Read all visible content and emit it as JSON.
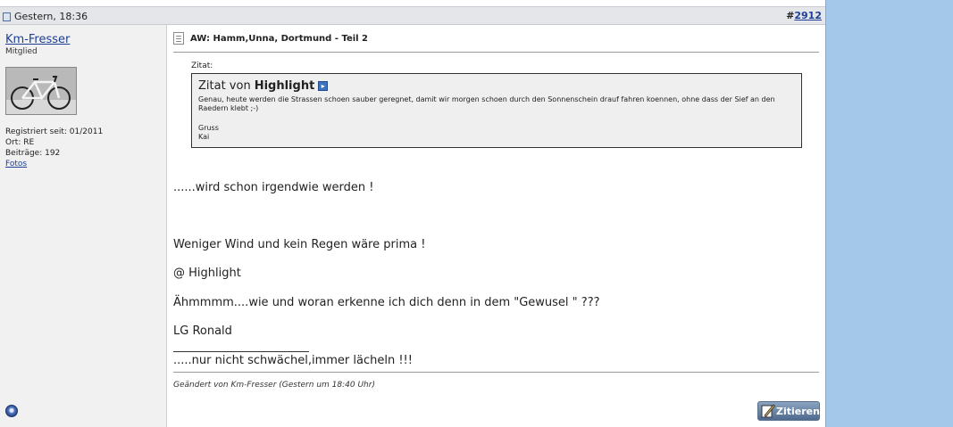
{
  "header": {
    "date": "Gestern, 18:36",
    "post_number_prefix": "#",
    "post_number": "2912"
  },
  "user": {
    "name": "Km-Fresser",
    "rank": "Mitglied",
    "registered": "Registriert seit: 01/2011",
    "location": "Ort: RE",
    "posts": "Beiträge: 192",
    "photos_link": "Fotos"
  },
  "post": {
    "title": "AW: Hamm,Unna, Dortmund - Teil 2",
    "quote_label": "Zitat:",
    "quote_prefix": "Zitat von",
    "quote_author": "Highlight",
    "quote_text": "Genau, heute werden die Strassen schoen sauber geregnet, damit wir morgen schoen durch den Sonnenschein drauf fahren koennen, ohne dass der Sief an den Raedern klebt ;-)",
    "quote_greeting": "Gruss",
    "quote_name": "Kai",
    "lines": [
      "......wird schon irgendwie werden !",
      "Weniger Wind und kein Regen wäre prima !",
      "@ Highlight",
      "Ähmmmm....wie und woran erkenne ich dich denn in dem \"Gewusel \" ???",
      "LG Ronald"
    ],
    "signature": ".....nur nicht schwächel,immer lächeln !!!",
    "edited": "Geändert von Km-Fresser (Gestern um 18:40 Uhr)",
    "quote_button": "Zitieren"
  }
}
